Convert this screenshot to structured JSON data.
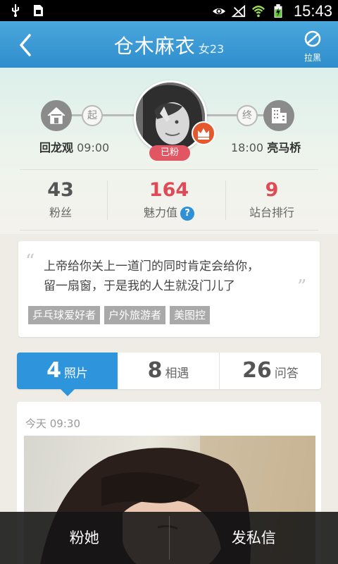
{
  "status_bar": {
    "time": "15:43",
    "icons": [
      "usb-icon",
      "sim-icon",
      "eye-icon",
      "no-signal-icon",
      "wifi-icon",
      "battery-charging-icon"
    ]
  },
  "header": {
    "back_icon": "chevron-left-icon",
    "name": "仓木麻衣",
    "meta": "女23",
    "block_label": "拉黑",
    "block_icon": "block-icon"
  },
  "route": {
    "start_tag": "起",
    "end_tag": "终",
    "start_place": "回龙观",
    "start_time": "09:00",
    "end_time": "18:00",
    "end_place": "亮马桥",
    "start_icon": "home-icon",
    "end_icon": "office-building-icon"
  },
  "avatar": {
    "badge": "已粉",
    "crown_icon": "crown-icon"
  },
  "stats": [
    {
      "value": "43",
      "label": "粉丝"
    },
    {
      "value": "164",
      "label": "魅力值",
      "help": "?"
    },
    {
      "value": "9",
      "label": "站台排行"
    }
  ],
  "quote": {
    "text_line1": "上帝给你关上一道门的同时肯定会给你，",
    "text_line2": "留一扇窗，于是我的人生就没门儿了",
    "open_mark": "“",
    "close_mark": "”",
    "tags": [
      "乒乓球爱好者",
      "户外旅游者",
      "美图控"
    ]
  },
  "tabs": [
    {
      "count": "4",
      "label": "照片",
      "active": true
    },
    {
      "count": "8",
      "label": "相遇",
      "active": false
    },
    {
      "count": "26",
      "label": "问答",
      "active": false
    }
  ],
  "post": {
    "time": "今天 09:30"
  },
  "actions": {
    "follow": "粉她",
    "message": "发私信"
  },
  "colors": {
    "header_blue": "#2f8dcc",
    "accent_red": "#e04a56",
    "tab_active": "#2e95dc"
  }
}
